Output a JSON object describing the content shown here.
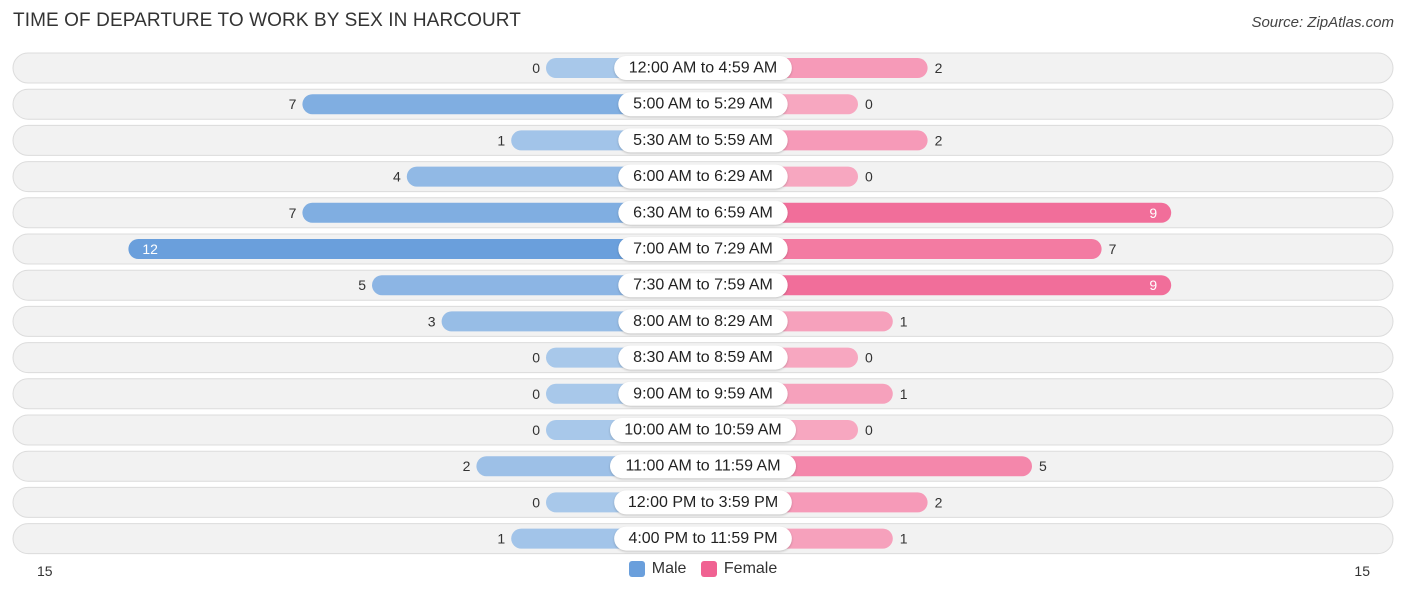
{
  "header": {
    "title": "TIME OF DEPARTURE TO WORK BY SEX IN HARCOURT",
    "source": "Source: ZipAtlas.com"
  },
  "colors": {
    "male": "#6a9fdc",
    "male_light": "#a8c8ea",
    "female": "#f06292",
    "female_light": "#f7a7c0"
  },
  "chart_data": {
    "type": "bar",
    "orientation": "horizontal-diverging",
    "title": "TIME OF DEPARTURE TO WORK BY SEX IN HARCOURT",
    "categories": [
      "12:00 AM to 4:59 AM",
      "5:00 AM to 5:29 AM",
      "5:30 AM to 5:59 AM",
      "6:00 AM to 6:29 AM",
      "6:30 AM to 6:59 AM",
      "7:00 AM to 7:29 AM",
      "7:30 AM to 7:59 AM",
      "8:00 AM to 8:29 AM",
      "8:30 AM to 8:59 AM",
      "9:00 AM to 9:59 AM",
      "10:00 AM to 10:59 AM",
      "11:00 AM to 11:59 AM",
      "12:00 PM to 3:59 PM",
      "4:00 PM to 11:59 PM"
    ],
    "series": [
      {
        "name": "Male",
        "values": [
          0,
          7,
          1,
          4,
          7,
          12,
          5,
          3,
          0,
          0,
          0,
          2,
          0,
          1
        ]
      },
      {
        "name": "Female",
        "values": [
          2,
          0,
          2,
          0,
          9,
          7,
          9,
          1,
          0,
          1,
          0,
          5,
          2,
          1
        ]
      }
    ],
    "axis": {
      "left_label": "15",
      "right_label": "15",
      "range": [
        0,
        15
      ]
    },
    "legend": {
      "position": "bottom-center",
      "entries": [
        "Male",
        "Female"
      ]
    },
    "grid": false
  }
}
